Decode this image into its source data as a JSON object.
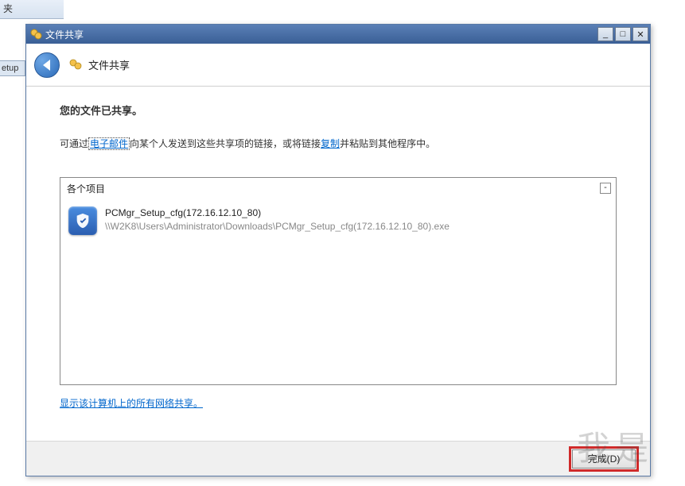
{
  "background": {
    "partial_folder_char": "夹",
    "partial_tab": "etup"
  },
  "dialog": {
    "titlebar": {
      "title": "文件共享"
    },
    "header": {
      "title": "文件共享"
    },
    "content": {
      "heading": "您的文件已共享。",
      "desc_pre": "可通过",
      "desc_link1": "电子邮件",
      "desc_mid": "向某个人发送到这些共享项的链接，或将链接",
      "desc_link2": "复制",
      "desc_post": "并粘贴到其他程序中。",
      "list_header": "各个项目",
      "collapse_symbol": "-",
      "items": [
        {
          "name": "PCMgr_Setup_cfg(172.16.12.10_80)",
          "path": "\\\\W2K8\\Users\\Administrator\\Downloads\\PCMgr_Setup_cfg(172.16.12.10_80).exe"
        }
      ],
      "bottom_link": "显示该计算机上的所有网络共享。"
    },
    "buttons": {
      "done": "完成(D)"
    }
  },
  "watermark": {
    "main": "我是",
    "sub": ""
  }
}
